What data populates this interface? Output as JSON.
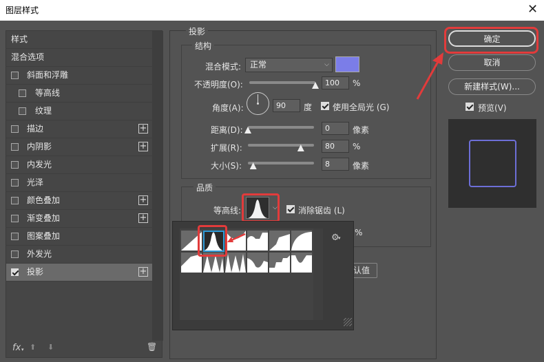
{
  "window": {
    "title": "图层样式",
    "close_glyph": "✕"
  },
  "sidebar": {
    "items": [
      {
        "label": "样式",
        "checkbox": false
      },
      {
        "label": "混合选项",
        "checkbox": false
      },
      {
        "label": "斜面和浮雕",
        "checkbox": true,
        "checked": false
      },
      {
        "label": "等高线",
        "checkbox": true,
        "checked": false,
        "sub": true
      },
      {
        "label": "纹理",
        "checkbox": true,
        "checked": false,
        "sub": true
      },
      {
        "label": "描边",
        "checkbox": true,
        "checked": false,
        "plus": true
      },
      {
        "label": "内阴影",
        "checkbox": true,
        "checked": false,
        "plus": true
      },
      {
        "label": "内发光",
        "checkbox": true,
        "checked": false
      },
      {
        "label": "光泽",
        "checkbox": true,
        "checked": false
      },
      {
        "label": "颜色叠加",
        "checkbox": true,
        "checked": false,
        "plus": true
      },
      {
        "label": "渐变叠加",
        "checkbox": true,
        "checked": false,
        "plus": true
      },
      {
        "label": "图案叠加",
        "checkbox": true,
        "checked": false
      },
      {
        "label": "外发光",
        "checkbox": true,
        "checked": false
      },
      {
        "label": "投影",
        "checkbox": true,
        "checked": true,
        "plus": true,
        "selected": true
      }
    ],
    "plus_glyph": "+",
    "footer": {
      "fx": "fx",
      "fx_arrow": "▾",
      "up": "⬆",
      "down": "⬇",
      "trash": "🗑"
    }
  },
  "drop_shadow": {
    "title": "投影",
    "structure": {
      "title": "结构",
      "blend_mode_label": "混合模式:",
      "blend_mode_value": "正常",
      "color": "#7b7de8",
      "opacity_label": "不透明度(O):",
      "opacity_value": "100",
      "opacity_level": 1.0,
      "unit_percent": "%",
      "angle_label": "角度(A):",
      "angle_value": "90",
      "angle_unit": "度",
      "global_light_label": "使用全局光 (G)",
      "distance_label": "距离(D):",
      "distance_value": "0",
      "distance_level": 0.0,
      "unit_px": "像素",
      "spread_label": "扩展(R):",
      "spread_value": "80",
      "spread_level": 0.8,
      "size_label": "大小(S):",
      "size_value": "8",
      "size_level": 0.08
    },
    "quality": {
      "title": "品质",
      "contour_label": "等高线:",
      "antialias_label": "消除锯齿 (L)",
      "percent_fragment": "%",
      "default_fragment": "认值",
      "gear_glyph": "⚙"
    }
  },
  "buttons": {
    "ok": "确定",
    "cancel": "取消",
    "new_style": "新建样式(W)...",
    "preview_label": "预览(V)"
  },
  "colors": {
    "highlight": "#e23b3b",
    "selection": "#2d9bd8",
    "preview_border": "#6d6fd8"
  }
}
